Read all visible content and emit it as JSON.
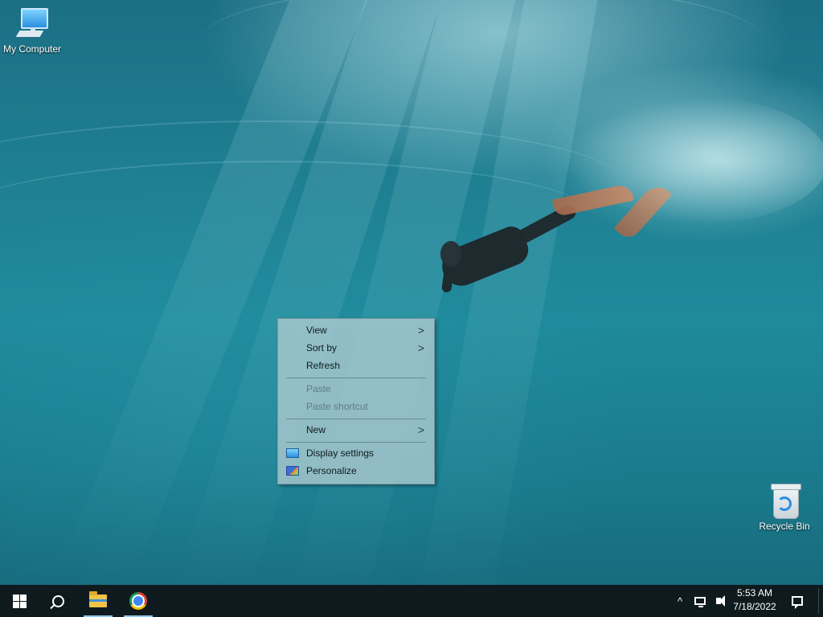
{
  "desktop": {
    "icons": [
      {
        "label": "My Computer"
      },
      {
        "label": "Recycle Bin"
      }
    ]
  },
  "context_menu": {
    "items": [
      {
        "label": "View",
        "submenu": true,
        "enabled": true
      },
      {
        "label": "Sort by",
        "submenu": true,
        "enabled": true
      },
      {
        "label": "Refresh",
        "submenu": false,
        "enabled": true
      },
      {
        "label": "Paste",
        "submenu": false,
        "enabled": false
      },
      {
        "label": "Paste shortcut",
        "submenu": false,
        "enabled": false
      },
      {
        "label": "New",
        "submenu": true,
        "enabled": true
      },
      {
        "label": "Display settings",
        "submenu": false,
        "enabled": true,
        "icon": "display-icon"
      },
      {
        "label": "Personalize",
        "submenu": false,
        "enabled": true,
        "icon": "personalize-icon"
      }
    ],
    "arrow_glyph": ">"
  },
  "taskbar": {
    "pinned": [
      {
        "icon": "windows-start-icon"
      },
      {
        "icon": "search-icon"
      },
      {
        "icon": "file-explorer-icon",
        "running": true
      },
      {
        "icon": "chrome-icon",
        "running": true
      }
    ],
    "tray": {
      "chevron": "^",
      "time": "5:53 AM",
      "date": "7/18/2022"
    }
  },
  "colors": {
    "taskbar_bg": "#0f1a1e",
    "menu_bg": "#aac8ce",
    "accent_running": "#8cc6f0"
  }
}
